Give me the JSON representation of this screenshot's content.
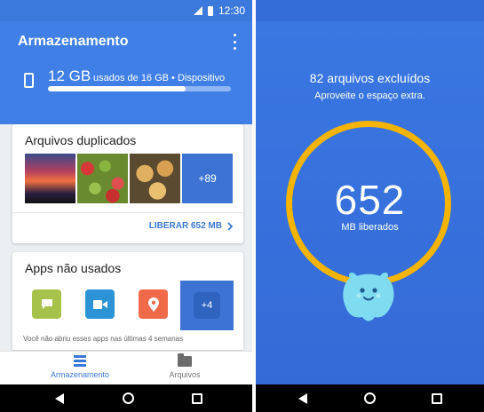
{
  "status_bar": {
    "time": "12:30"
  },
  "storage_screen": {
    "app_title": "Armazenamento",
    "storage": {
      "used": "12 GB",
      "detail": "usados de 16 GB • Dispositivo",
      "used_fraction": 0.75
    },
    "duplicates_card": {
      "title": "Arquivos duplicados",
      "thumbnails": [
        "sunset-photo",
        "apples-photo",
        "pastries-photo",
        "church-photo"
      ],
      "more_count": "+89",
      "action": "LIBERAR 652 MB"
    },
    "unused_apps_card": {
      "title": "Apps não usados",
      "apps": [
        "messages-app-icon",
        "video-app-icon",
        "maps-app-icon"
      ],
      "more_count": "+4",
      "note": "Você não abriu esses apps nas últimas 4 semanas"
    },
    "bottom_nav": [
      {
        "label": "Armazenamento",
        "icon": "list-icon",
        "active": true
      },
      {
        "label": "Arquivos",
        "icon": "folder-icon",
        "active": false
      }
    ]
  },
  "result_screen": {
    "title": "82 arquivos excluídos",
    "subtitle": "Aproveite o espaço extra.",
    "freed_value": "652",
    "freed_unit": "MB liberados"
  },
  "colors": {
    "primary_blue": "#3f7fe6",
    "ring_yellow": "#f4b400",
    "mascot_cyan": "#7fdcf0",
    "link_blue": "#3c78d8"
  }
}
